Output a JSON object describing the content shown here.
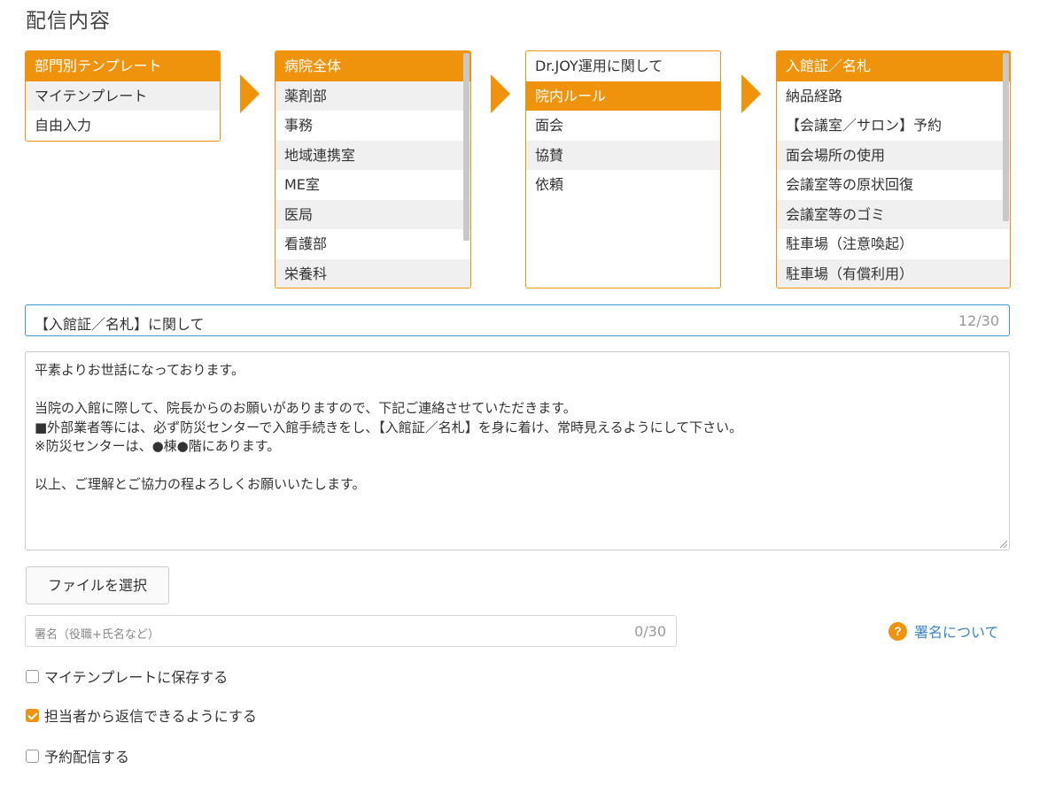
{
  "title": "配信内容",
  "colors": {
    "accent": "#f0930c",
    "focus": "#3d9ad6",
    "link": "#3d87c4"
  },
  "selectors": {
    "category": [
      "部門別テンプレート",
      "マイテンプレート",
      "自由入力"
    ],
    "department": [
      "病院全体",
      "薬剤部",
      "事務",
      "地域連携室",
      "ME室",
      "医局",
      "看護部",
      "栄養科"
    ],
    "topic": [
      "Dr.JOY運用に関して",
      "院内ルール",
      "面会",
      "協賛",
      "依頼"
    ],
    "template": [
      "入館証／名札",
      "納品経路",
      "【会議室／サロン】予約",
      "面会場所の使用",
      "会議室等の原状回復",
      "会議室等のゴミ",
      "駐車場（注意喚起）",
      "駐車場（有償利用）"
    ]
  },
  "subject": {
    "value": "【入館証／名札】に関して",
    "counter": "12/30"
  },
  "body_lines": [
    "平素よりお世話になっております。",
    "",
    "当院の入館に際して、院長からのお願いがありますので、下記ご連絡させていただきます。",
    "■外部業者等には、必ず防災センターで入館手続きをし、【入館証／名札】を身に着け、常時見えるようにして下さい。",
    "※防災センターは、●棟●階にあります。",
    "",
    "以上、ご理解とご協力の程よろしくお願いいたします。"
  ],
  "file_button": "ファイルを選択",
  "signature": {
    "placeholder": "署名（役職+氏名など）",
    "counter": "0/30"
  },
  "signature_help": "署名について",
  "options": [
    {
      "label": "マイテンプレートに保存する",
      "checked": false
    },
    {
      "label": "担当者から返信できるようにする",
      "checked": true
    },
    {
      "label": "予約配信する",
      "checked": false
    }
  ]
}
